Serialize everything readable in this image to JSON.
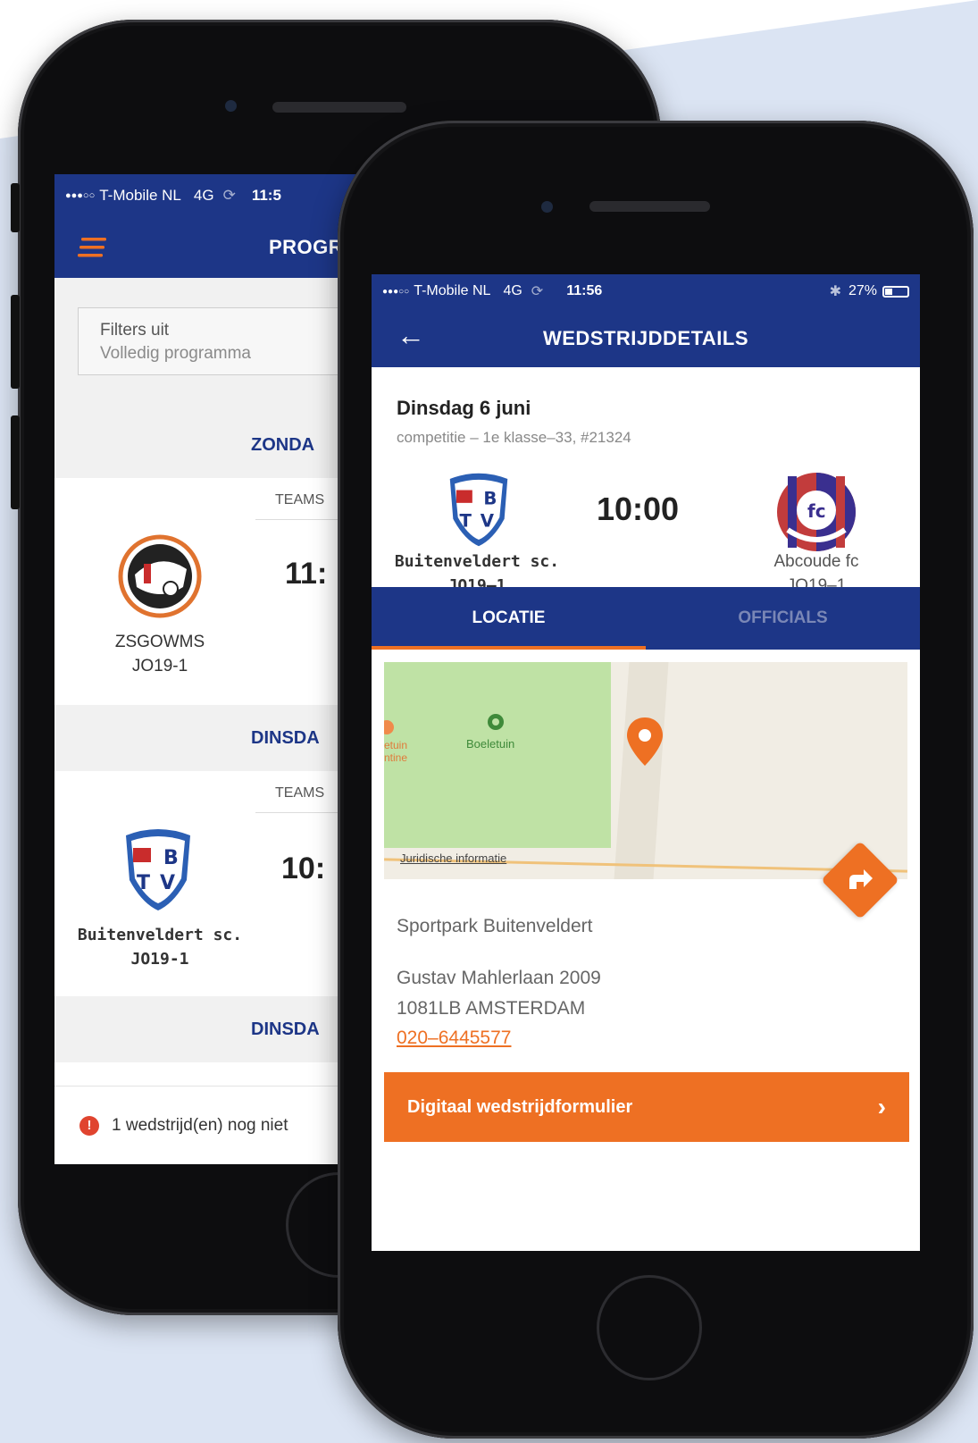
{
  "colors": {
    "brand_blue": "#1d3687",
    "accent_orange": "#ee7023",
    "background_band": "#dbe4f3"
  },
  "back_screen": {
    "status": {
      "signal": "●●●○○",
      "carrier": "T-Mobile NL",
      "network": "4G",
      "time": "11:5"
    },
    "nav": {
      "menu_icon": "hamburger-icon",
      "title": "PROGR"
    },
    "filters": {
      "title": "Filters uit",
      "subtitle": "Volledig programma"
    },
    "sections": [
      {
        "day": "ZONDA",
        "teams_label": "TEAMS",
        "time": "11:",
        "team_name": "ZSGOWMS",
        "team_category": "JO19-1"
      },
      {
        "day": "DINSDA",
        "teams_label": "TEAMS",
        "time": "10:",
        "team_name": "Buitenveldert sc.",
        "team_category": "JO19-1"
      },
      {
        "day": "DINSDA"
      }
    ],
    "warning": {
      "icon": "!",
      "text": "1 wedstrijd(en) nog niet"
    }
  },
  "front_screen": {
    "status": {
      "signal": "●●●○○",
      "carrier": "T-Mobile NL",
      "network": "4G",
      "time": "11:56",
      "battery": "27%"
    },
    "nav": {
      "back_icon": "back-arrow-icon",
      "back_glyph": "←",
      "title": "WEDSTRIJDDETAILS"
    },
    "match": {
      "date": "Dinsdag 6 juni",
      "competition": "competitie – 1e klasse–33, #21324",
      "time": "10:00",
      "home_name": "Buitenveldert  sc.",
      "home_category": "JO19–1",
      "away_name": "Abcoude fc",
      "away_category": "JO19–1"
    },
    "tabs": [
      {
        "label": "LOCATIE",
        "active": true
      },
      {
        "label": "OFFICIALS",
        "active": false
      }
    ],
    "map": {
      "park_label": "Boeletuin",
      "side_label": "etuin\nntine",
      "legal_link": "Juridische informatie"
    },
    "location": {
      "venue": "Sportpark Buitenveldert",
      "address_line1": "Gustav Mahlerlaan 2009",
      "address_line2": "1081LB AMSTERDAM",
      "phone": "020–6445577"
    },
    "cta": {
      "label": "Digitaal wedstrijdformulier",
      "chevron": "›"
    }
  }
}
